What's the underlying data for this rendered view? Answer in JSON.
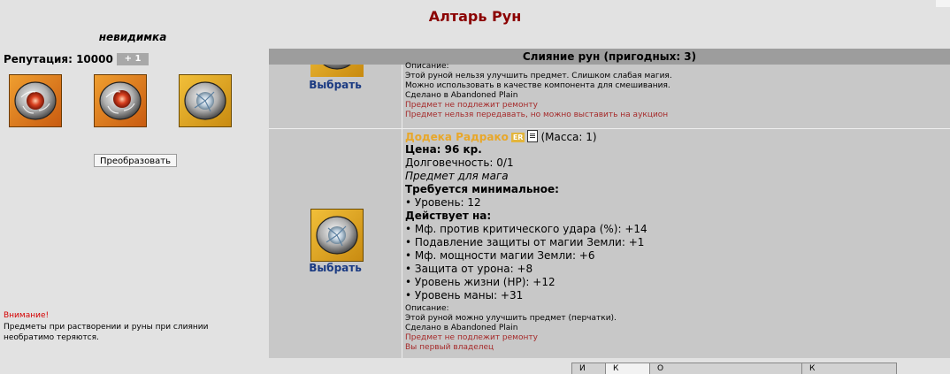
{
  "page": {
    "title": "Алтарь Рун"
  },
  "player": {
    "name": "невидимка",
    "reputation_label": "Репутация: 10000",
    "reputation_bonus": "+ 1"
  },
  "rune_slots": [
    {
      "icon": "red-rune-icon"
    },
    {
      "icon": "red-rune-icon"
    },
    {
      "icon": "silver-rune-icon"
    }
  ],
  "convert_button": "Преобразовать",
  "warning": {
    "title": "Внимание!",
    "text": "Предметы при растворении и руны при слиянии необратимо теряются."
  },
  "merge_panel": {
    "header": "Слияние рун (пригодных: 3)",
    "items": [
      {
        "select": "Выбрать",
        "lines": [
          "Описание:",
          "Этой руной нельзя улучшить предмет. Слишком слабая магия.",
          "Можно использовать в качестве компонента для смешивания.",
          "Сделано в Abandoned Plain"
        ],
        "warnings": [
          "Предмет не подлежит ремонту",
          "Предмет нельзя передавать, но можно выставить на аукцион"
        ]
      },
      {
        "select": "Выбрать",
        "name": "Додека Радрако",
        "badge": "ER",
        "mass": "(Масса: 1)",
        "price": "Цена: 96 кр.",
        "durability": "Долговечность: 0/1",
        "type": "Предмет для мага",
        "req_title": "Требуется минимальное:",
        "req_level": "• Уровень: 12",
        "effects_title": "Действует на:",
        "effects": [
          "• Мф. против критического удара (%): +14",
          "• Подавление защиты от магии Земли: +1",
          "• Мф. мощности магии Земли: +6",
          "• Защита от урона: +8",
          "• Уровень жизни (HP): +12",
          "• Уровень маны: +31"
        ],
        "desc_title": "Описание:",
        "desc": "Этой руной можно улучшить предмет (перчатки).",
        "made_in": "Сделано в Abandoned Plain",
        "warnings": [
          "Предмет не подлежит ремонту",
          "Вы первый владелец"
        ]
      }
    ]
  },
  "bottom_tabs": [
    "И",
    "К",
    "О",
    "К"
  ]
}
